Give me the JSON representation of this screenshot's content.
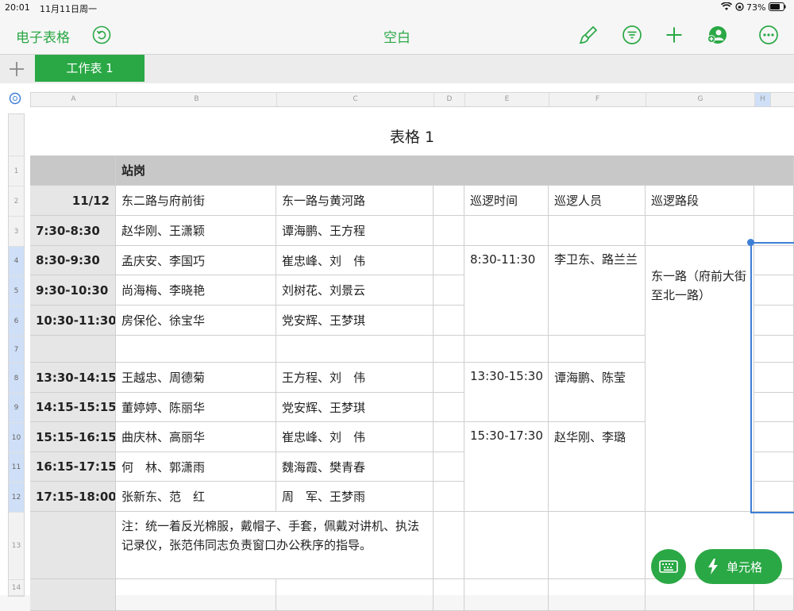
{
  "status": {
    "time": "20:01",
    "date": "11月11日周一",
    "battery": "73%"
  },
  "toolbar": {
    "app_name": "电子表格",
    "doc_title": "空白"
  },
  "tabs": {
    "add_icon": "plus-icon",
    "sheet1": "工作表 1"
  },
  "columns": [
    "A",
    "B",
    "C",
    "D",
    "E",
    "F",
    "G",
    "H"
  ],
  "row_numbers": [
    "1",
    "2",
    "3",
    "4",
    "5",
    "6",
    "7",
    "8",
    "9",
    "10",
    "11",
    "12",
    "13",
    "14"
  ],
  "table": {
    "title": "表格 1",
    "header": "站岗",
    "date": "11/12",
    "post1": "东二路与府前街",
    "post2": "东一路与黄河路",
    "patrol_time": "巡逻时间",
    "patrol_staff": "巡逻人员",
    "patrol_route": "巡逻路段",
    "rows": [
      {
        "time": "7:30-8:30",
        "b": "赵华刚、王潇颖",
        "c": "谭海鹏、王方程"
      },
      {
        "time": "8:30-9:30",
        "b": "孟庆安、李国巧",
        "c": "崔忠峰、刘　伟"
      },
      {
        "time": "9:30-10:30",
        "b": "尚海梅、李晓艳",
        "c": "刘树花、刘景云"
      },
      {
        "time": "10:30-11:30",
        "b": "房保伦、徐宝华",
        "c": "党安辉、王梦琪"
      },
      {
        "time": "",
        "b": "",
        "c": ""
      },
      {
        "time": "13:30-14:15",
        "b": "王越忠、周德菊",
        "c": "王方程、刘　伟"
      },
      {
        "time": "14:15-15:15",
        "b": "董婷婷、陈丽华",
        "c": "党安辉、王梦琪"
      },
      {
        "time": "15:15-16:15",
        "b": "曲庆林、高丽华",
        "c": "崔忠峰、刘　伟"
      },
      {
        "time": "16:15-17:15",
        "b": "何　林、郭潇雨",
        "c": "魏海霞、樊青春"
      },
      {
        "time": "17:15-18:00",
        "b": "张新东、范　红",
        "c": "周　军、王梦雨"
      }
    ],
    "patrol1_time": "8:30-11:30",
    "patrol1_staff": "李卫东、路兰兰",
    "patrol2_time": "13:30-15:30",
    "patrol2_staff": "谭海鹏、陈莹",
    "patrol3_time": "15:30-17:30",
    "patrol3_staff": "赵华刚、李璐",
    "route": "东一路（府前大街至北一路）",
    "note": "注：统一着反光棉服，戴帽子、手套，佩戴对讲机、执法记录仪，张范伟同志负责窗口办公秩序的指导。"
  },
  "buttons": {
    "cell": "单元格"
  },
  "colors": {
    "accent": "#2aa845",
    "selection": "#3d7fd6"
  }
}
